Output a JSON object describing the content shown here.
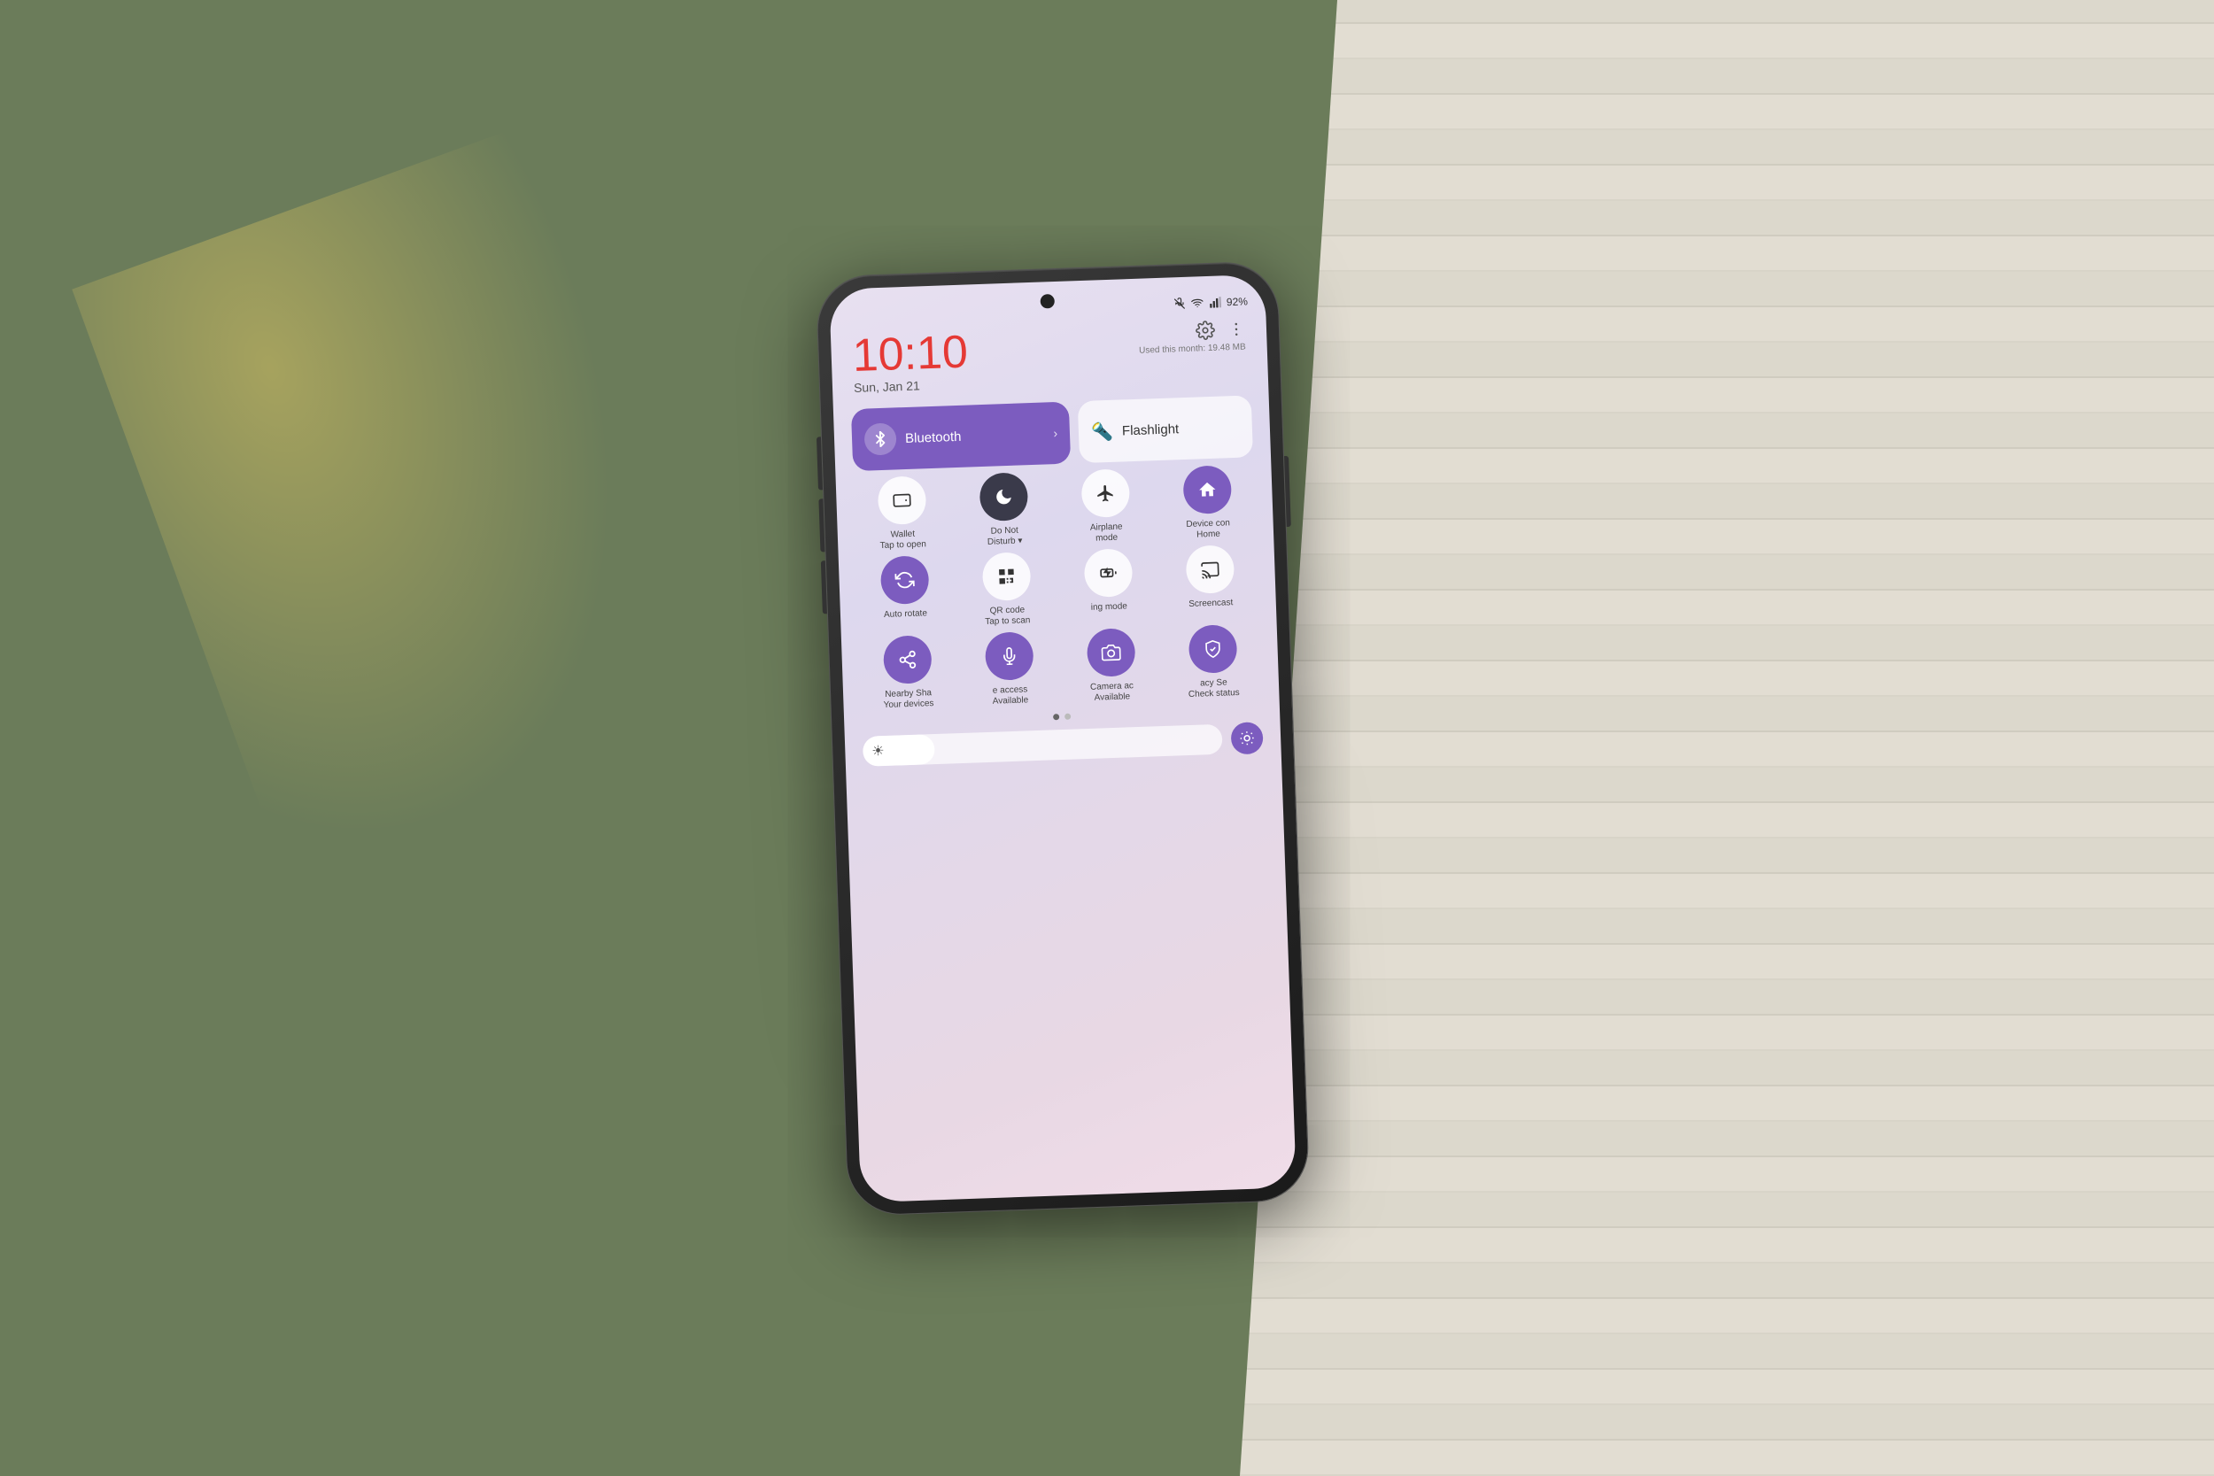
{
  "background": {
    "left_color": "#6b7c5a",
    "right_color": "#d8d4c8"
  },
  "status_bar": {
    "time": "10:10",
    "time_red": "1",
    "date": "Sun, Jan 21",
    "battery": "92%",
    "usage": "Used this month: 19.48 MB"
  },
  "tiles": {
    "bluetooth": {
      "label": "Bluetooth",
      "active": true
    },
    "flashlight": {
      "label": "Flashlight",
      "active": false
    }
  },
  "icon_grid_row1": [
    {
      "name": "wallet",
      "label": "Wallet\nTap to open",
      "style": "white",
      "icon": "💳"
    },
    {
      "name": "do-not-disturb",
      "label": "Do Not\nDisturb",
      "style": "dark",
      "icon": "🌙"
    },
    {
      "name": "airplane-mode",
      "label": "Airplane\nmode",
      "style": "white",
      "icon": "✈"
    },
    {
      "name": "device-controls",
      "label": "Device con\nHome",
      "style": "purple",
      "icon": "🏠"
    }
  ],
  "icon_grid_row2": [
    {
      "name": "auto-rotate",
      "label": "Auto rotate",
      "style": "purple",
      "icon": "↺"
    },
    {
      "name": "qr-code",
      "label": "QR code\nTap to scan",
      "style": "white",
      "icon": "▦"
    },
    {
      "name": "charging-mode",
      "label": "ing mode",
      "style": "white",
      "icon": "⚡"
    },
    {
      "name": "screencast",
      "label": "Screencast",
      "style": "white",
      "icon": "📺"
    }
  ],
  "icon_grid_row3": [
    {
      "name": "nearby-share",
      "label": "Nearby Sha\nYour devices",
      "style": "purple",
      "icon": "⇌"
    },
    {
      "name": "mic-access",
      "label": "e access\nAvailable",
      "style": "purple",
      "icon": "🎙"
    },
    {
      "name": "camera-access",
      "label": "Camera ac\nAvailable",
      "style": "purple",
      "icon": "📷"
    },
    {
      "name": "privacy",
      "label": "acy Se\nCheck status",
      "style": "purple",
      "icon": "🛡"
    }
  ],
  "brightness": {
    "level": 20
  },
  "page_dots": {
    "active": 0,
    "total": 2
  }
}
